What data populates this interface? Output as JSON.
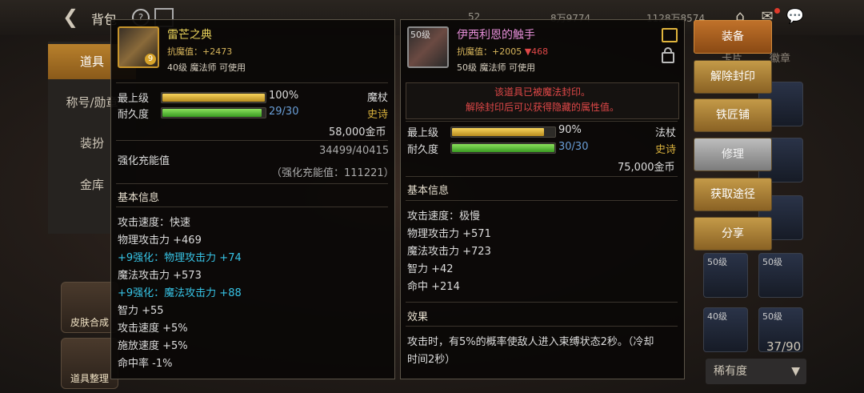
{
  "header": {
    "title": "背包",
    "res1": "52",
    "res2": "8万9774",
    "res3": "1128万8574"
  },
  "nav": {
    "items": [
      {
        "label": "道具"
      },
      {
        "label": "称号/勋章"
      },
      {
        "label": "装扮"
      },
      {
        "label": "金库"
      }
    ]
  },
  "side_buttons": [
    {
      "label": "皮肤合成"
    },
    {
      "label": "道具整理"
    }
  ],
  "right_tabs": [
    "卡片",
    "徽章"
  ],
  "inventory": {
    "slots": [
      {
        "label": "50级"
      },
      {
        "label": "50级"
      },
      {
        "label": "40级"
      },
      {
        "label": "50级"
      }
    ],
    "count": "37/90",
    "filter": "稀有度"
  },
  "item1": {
    "badge": "9",
    "name": "雷芒之典",
    "name_color": "#e8d25a",
    "resist_label": "抗魔值：",
    "resist_value": "+2473",
    "req": "40级 魔法师 可使用",
    "max_level_label": "最上级",
    "max_level_value": "100%",
    "max_level_pct": 100,
    "type": "魔杖",
    "durability_label": "耐久度",
    "durability_value": "29/30",
    "durability_pct": 96.7,
    "rarity": "史诗",
    "price": "58,000金币",
    "charge_label": "强化充能值",
    "charge_value": "34499/40415",
    "charge_sub": "（强化充能值：111221）",
    "basic_label": "基本信息",
    "stats": [
      {
        "text": "攻击速度：快速",
        "color": "#ddd"
      },
      {
        "text": "物理攻击力 +469",
        "color": "#ddd"
      },
      {
        "text": "+9强化：物理攻击力 +74",
        "color": "#37c4e6"
      },
      {
        "text": "魔法攻击力 +573",
        "color": "#ddd"
      },
      {
        "text": "+9强化：魔法攻击力 +88",
        "color": "#37c4e6"
      },
      {
        "text": "智力 +55",
        "color": "#ddd"
      },
      {
        "text": "攻击速度 +5%",
        "color": "#ddd"
      },
      {
        "text": "施放速度 +5%",
        "color": "#ddd"
      },
      {
        "text": "命中率 -1%",
        "color": "#ddd"
      }
    ]
  },
  "item2": {
    "level_badge": "50级",
    "name": "伊西利恩的触手",
    "name_color": "#e78fd9",
    "resist_label": "抗魔值：",
    "resist_value": "+2005",
    "resist_down": "▼468",
    "req": "50级 魔法师 可使用",
    "seal_line1": "该道具已被魔法封印。",
    "seal_line2": "解除封印后可以获得隐藏的属性值。",
    "max_level_label": "最上级",
    "max_level_value": "90%",
    "max_level_pct": 90,
    "type": "法杖",
    "durability_label": "耐久度",
    "durability_value": "30/30",
    "durability_pct": 100,
    "rarity": "史诗",
    "price": "75,000金币",
    "basic_label": "基本信息",
    "stats": [
      {
        "text": "攻击速度：极慢"
      },
      {
        "text": "物理攻击力 +571"
      },
      {
        "text": "魔法攻击力 +723"
      },
      {
        "text": "智力 +42"
      },
      {
        "text": "命中 +214"
      }
    ],
    "effect_label": "效果",
    "effect_line1": "攻击时，有5%的概率使敌人进入束缚状态2秒。（冷却",
    "effect_line2": "时间2秒）"
  },
  "actions": [
    {
      "label": "装备"
    },
    {
      "label": "解除封印"
    },
    {
      "label": "铁匠铺"
    },
    {
      "label": "修理"
    },
    {
      "label": "获取途径"
    },
    {
      "label": "分享"
    }
  ]
}
